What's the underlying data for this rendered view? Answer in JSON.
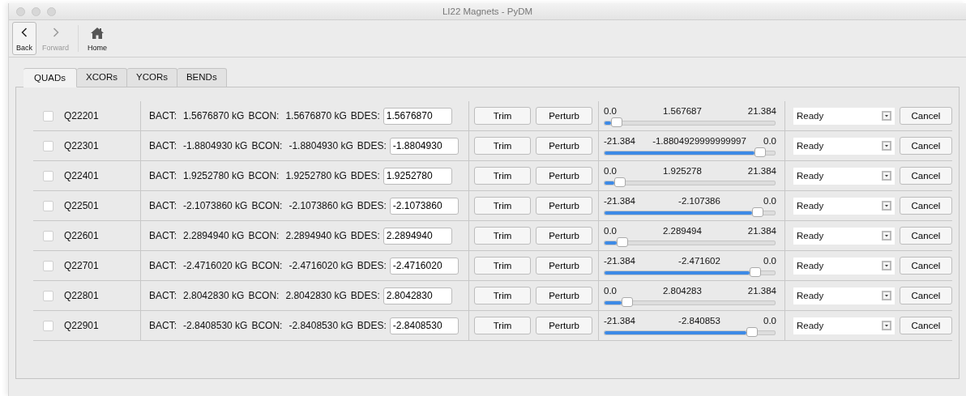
{
  "window": {
    "title": "LI22 Magnets - PyDM"
  },
  "toolbar": [
    {
      "kind": "back",
      "label": "Back",
      "disabled": false
    },
    {
      "kind": "forward",
      "label": "Forward",
      "disabled": true
    },
    {
      "kind": "home",
      "label": "Home",
      "disabled": false
    }
  ],
  "tabs": [
    {
      "label": "QUADs",
      "selected": true
    },
    {
      "label": "XCORs",
      "selected": false
    },
    {
      "label": "YCORs",
      "selected": false
    },
    {
      "label": "BENDs",
      "selected": false
    }
  ],
  "rows": [
    {
      "checked": false,
      "name": "Q22201",
      "bact_label": "BACT:",
      "bact": "1.5676870 kG",
      "bcon_label": "BCON:",
      "bcon": "1.5676870 kG",
      "bdes_label": "BDES:",
      "bdes": "1.5676870",
      "trim": "Trim",
      "perturb": "Perturb",
      "slider_min": "0.0",
      "slider_value": "1.567687",
      "slider_max": "21.384",
      "level": 0.073,
      "status": "Ready",
      "cancel": "Cancel"
    },
    {
      "checked": false,
      "name": "Q22301",
      "bact_label": "BACT:",
      "bact": "-1.8804930 kG",
      "bcon_label": "BCON:",
      "bcon": "-1.8804930 kG",
      "bdes_label": "BDES:",
      "bdes": "-1.8804930",
      "trim": "Trim",
      "perturb": "Perturb",
      "slider_min": "-21.384",
      "slider_value": "-1.8804929999999997",
      "slider_max": "0.0",
      "level": 0.912,
      "status": "Ready",
      "cancel": "Cancel"
    },
    {
      "checked": false,
      "name": "Q22401",
      "bact_label": "BACT:",
      "bact": "1.9252780 kG",
      "bcon_label": "BCON:",
      "bcon": "1.9252780 kG",
      "bdes_label": "BDES:",
      "bdes": "1.9252780",
      "trim": "Trim",
      "perturb": "Perturb",
      "slider_min": "0.0",
      "slider_value": "1.925278",
      "slider_max": "21.384",
      "level": 0.09,
      "status": "Ready",
      "cancel": "Cancel"
    },
    {
      "checked": false,
      "name": "Q22501",
      "bact_label": "BACT:",
      "bact": "-2.1073860 kG",
      "bcon_label": "BCON:",
      "bcon": "-2.1073860 kG",
      "bdes_label": "BDES:",
      "bdes": "-2.1073860",
      "trim": "Trim",
      "perturb": "Perturb",
      "slider_min": "-21.384",
      "slider_value": "-2.107386",
      "slider_max": "0.0",
      "level": 0.901,
      "status": "Ready",
      "cancel": "Cancel"
    },
    {
      "checked": false,
      "name": "Q22601",
      "bact_label": "BACT:",
      "bact": "2.2894940 kG",
      "bcon_label": "BCON:",
      "bcon": "2.2894940 kG",
      "bdes_label": "BDES:",
      "bdes": "2.2894940",
      "trim": "Trim",
      "perturb": "Perturb",
      "slider_min": "0.0",
      "slider_value": "2.289494",
      "slider_max": "21.384",
      "level": 0.107,
      "status": "Ready",
      "cancel": "Cancel"
    },
    {
      "checked": false,
      "name": "Q22701",
      "bact_label": "BACT:",
      "bact": "-2.4716020 kG",
      "bcon_label": "BCON:",
      "bcon": "-2.4716020 kG",
      "bdes_label": "BDES:",
      "bdes": "-2.4716020",
      "trim": "Trim",
      "perturb": "Perturb",
      "slider_min": "-21.384",
      "slider_value": "-2.471602",
      "slider_max": "0.0",
      "level": 0.884,
      "status": "Ready",
      "cancel": "Cancel"
    },
    {
      "checked": false,
      "name": "Q22801",
      "bact_label": "BACT:",
      "bact": "2.8042830 kG",
      "bcon_label": "BCON:",
      "bcon": "2.8042830 kG",
      "bdes_label": "BDES:",
      "bdes": "2.8042830",
      "trim": "Trim",
      "perturb": "Perturb",
      "slider_min": "0.0",
      "slider_value": "2.804283",
      "slider_max": "21.384",
      "level": 0.131,
      "status": "Ready",
      "cancel": "Cancel"
    },
    {
      "checked": false,
      "name": "Q22901",
      "bact_label": "BACT:",
      "bact": "-2.8408530 kG",
      "bcon_label": "BCON:",
      "bcon": "-2.8408530 kG",
      "bdes_label": "BDES:",
      "bdes": "-2.8408530",
      "trim": "Trim",
      "perturb": "Perturb",
      "slider_min": "-21.384",
      "slider_value": "-2.840853",
      "slider_max": "0.0",
      "level": 0.867,
      "status": "Ready",
      "cancel": "Cancel"
    }
  ]
}
